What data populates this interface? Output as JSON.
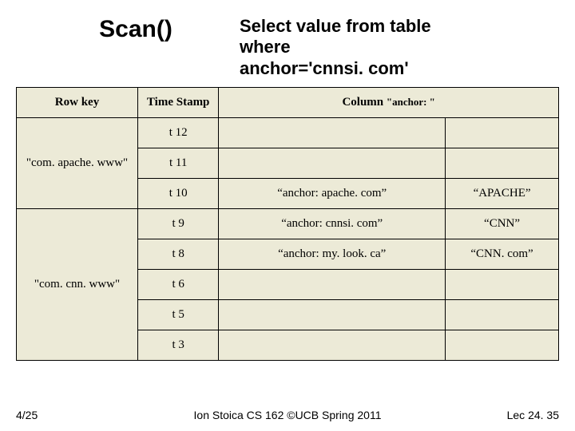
{
  "header": {
    "scan": "Scan()",
    "query_l1": "Select value from table",
    "query_l2": "where",
    "query_l3": "anchor='cnnsi. com'"
  },
  "table": {
    "head": {
      "rowkey": "Row key",
      "timestamp": "Time Stamp",
      "column_prefix": "Column ",
      "column_quoted": "\"anchor: \""
    },
    "rowkeys": {
      "apache": "\"com. apache. www\"",
      "cnn": "\"com. cnn. www\""
    },
    "rows": [
      {
        "ts": "t 12",
        "col": "",
        "val": ""
      },
      {
        "ts": "t 11",
        "col": "",
        "val": ""
      },
      {
        "ts": "t 10",
        "col": "“anchor: apache. com”",
        "val": "“APACHE”"
      },
      {
        "ts": "t 9",
        "col": "“anchor: cnnsi. com”",
        "val": "“CNN”"
      },
      {
        "ts": "t 8",
        "col": "“anchor: my. look. ca”",
        "val": "“CNN. com”"
      },
      {
        "ts": "t 6",
        "col": "",
        "val": ""
      },
      {
        "ts": "t 5",
        "col": "",
        "val": ""
      },
      {
        "ts": "t 3",
        "col": "",
        "val": ""
      }
    ]
  },
  "footer": {
    "left": "4/25",
    "center": "Ion Stoica CS 162 ©UCB Spring 2011",
    "right": "Lec 24. 35"
  }
}
